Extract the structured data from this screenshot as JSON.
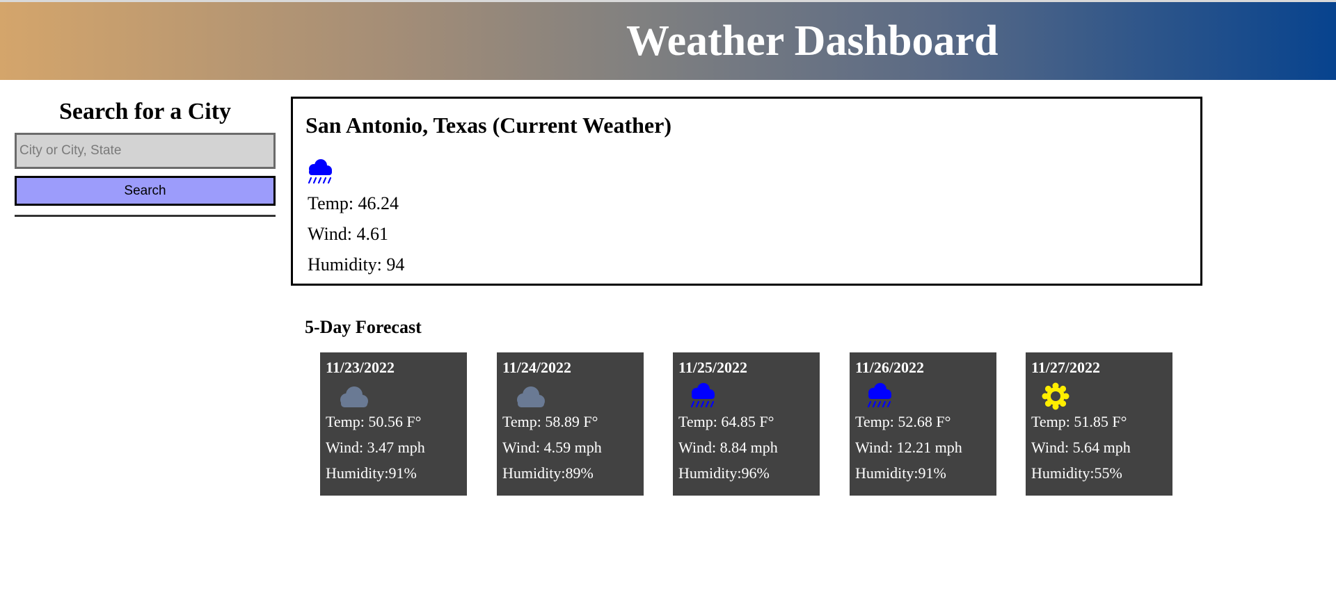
{
  "header": {
    "title": "Weather Dashboard"
  },
  "sidebar": {
    "title": "Search for a City",
    "search_placeholder": "City or City, State",
    "search_value": "",
    "search_button": "Search"
  },
  "current": {
    "heading": "San Antonio, Texas (Current Weather)",
    "icon": "rain-icon",
    "temp": "Temp: 46.24",
    "wind": "Wind: 4.61",
    "humidity": "Humidity: 94"
  },
  "forecast": {
    "title": "5-Day Forecast",
    "days": [
      {
        "date": "11/23/2022",
        "icon": "cloud-icon",
        "temp": "Temp: 50.56 F°",
        "wind": "Wind: 3.47 mph",
        "humidity": "Humidity:91%"
      },
      {
        "date": "11/24/2022",
        "icon": "cloud-icon",
        "temp": "Temp: 58.89 F°",
        "wind": "Wind: 4.59 mph",
        "humidity": "Humidity:89%"
      },
      {
        "date": "11/25/2022",
        "icon": "rain-icon",
        "temp": "Temp: 64.85 F°",
        "wind": "Wind: 8.84 mph",
        "humidity": "Humidity:96%"
      },
      {
        "date": "11/26/2022",
        "icon": "rain-icon",
        "temp": "Temp: 52.68 F°",
        "wind": "Wind: 12.21 mph",
        "humidity": "Humidity:91%"
      },
      {
        "date": "11/27/2022",
        "icon": "sun-icon",
        "temp": "Temp: 51.85 F°",
        "wind": "Wind: 5.64 mph",
        "humidity": "Humidity:55%"
      }
    ]
  },
  "colors": {
    "header_gradient_start": "#d4a56b",
    "header_gradient_end": "#07438e",
    "card_background": "#424242",
    "search_button": "#9c9cfb",
    "rain_icon": "#0000ff",
    "cloud_icon": "#6a7a94",
    "sun_icon": "#ffee00"
  }
}
